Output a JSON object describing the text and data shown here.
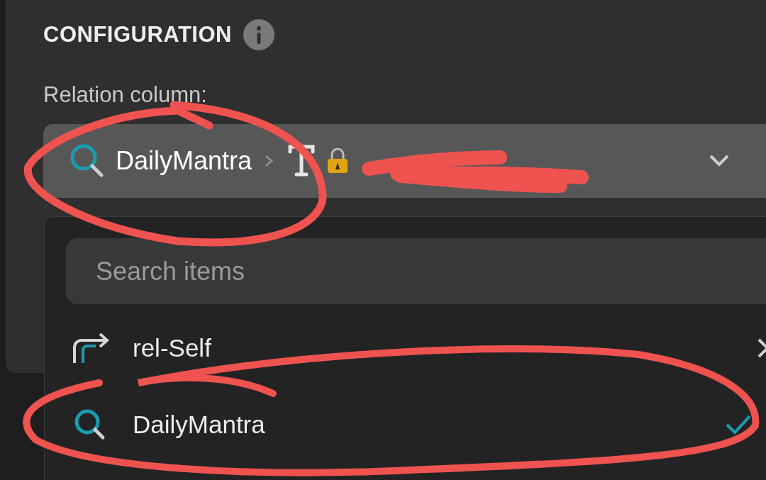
{
  "panel": {
    "title": "CONFIGURATION",
    "field_label": "Relation column:"
  },
  "select": {
    "value": "DailyMantra"
  },
  "dropdown": {
    "search": {
      "placeholder": "Search items"
    },
    "items": [
      {
        "kind": "relation",
        "label": "rel-Self",
        "selected": false,
        "removable": true
      },
      {
        "kind": "lookup",
        "label": "DailyMantra",
        "selected": true,
        "removable": false
      }
    ]
  }
}
